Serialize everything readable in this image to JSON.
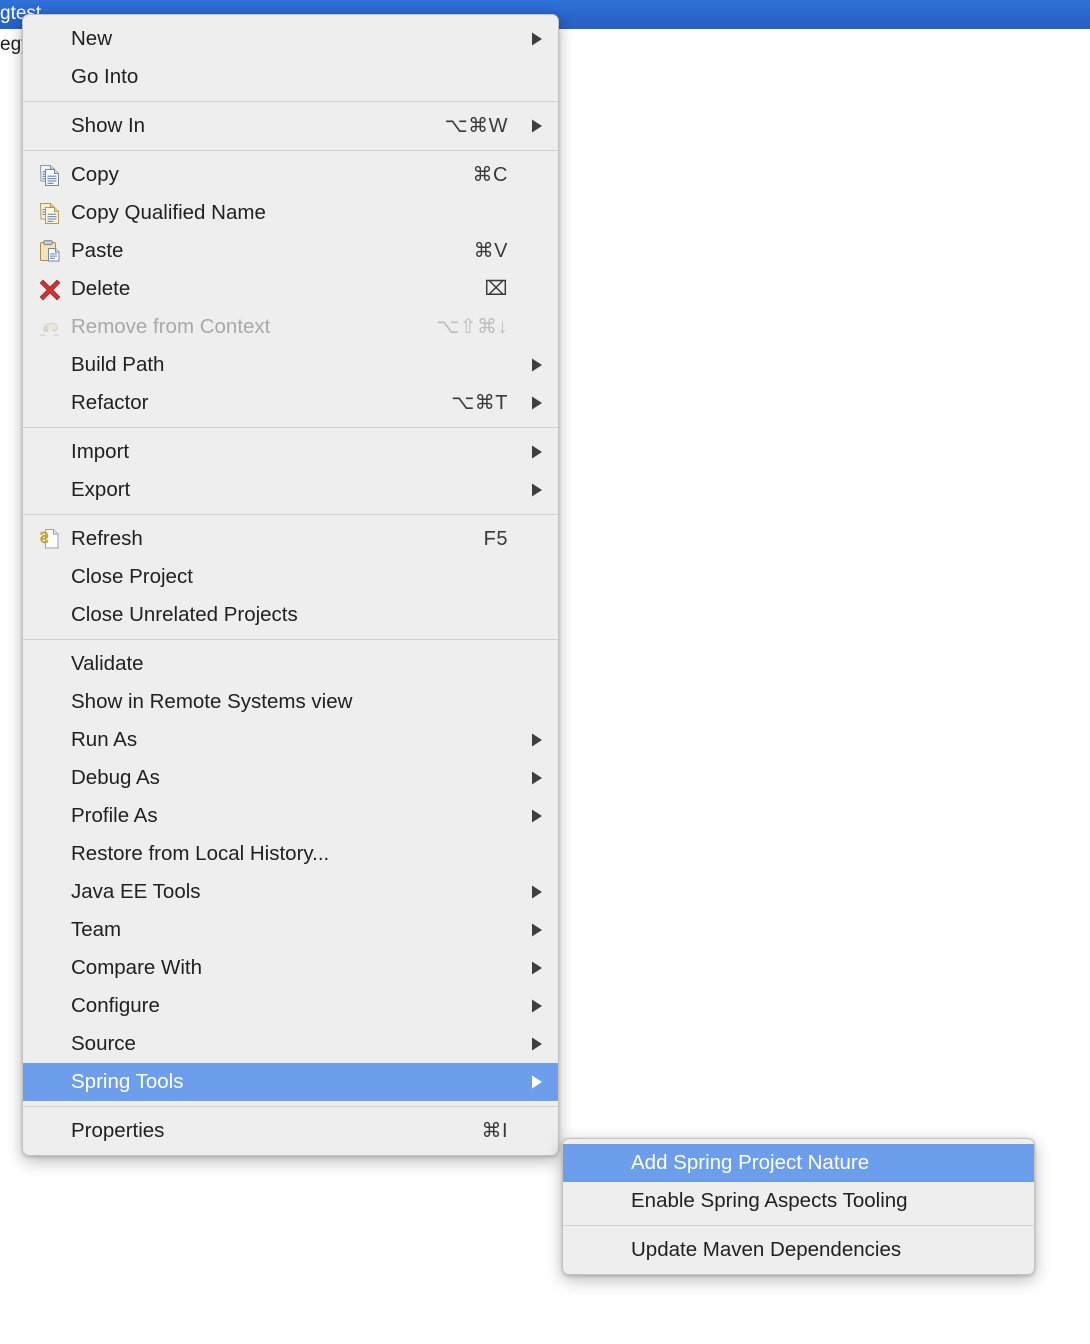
{
  "background": {
    "selected_tree_label": "gtest",
    "tree_label_2": "egy",
    "selection_color": "#2a66cb"
  },
  "theme": {
    "menu_background": "#eeeeee",
    "menu_border": "#c2c2c2",
    "highlight": "#6d9eeb",
    "text": "#212121",
    "disabled_text": "#a9a9a9",
    "separator": "#d2d2d2"
  },
  "context_menu": {
    "name": "project-context-menu",
    "groups": [
      {
        "items": [
          {
            "label": "New",
            "icon": "",
            "accel": "",
            "submenu": true,
            "enabled": true,
            "highlight": false
          },
          {
            "label": "Go Into",
            "icon": "",
            "accel": "",
            "submenu": false,
            "enabled": true,
            "highlight": false
          }
        ]
      },
      {
        "items": [
          {
            "label": "Show In",
            "icon": "",
            "accel": "⌥⌘W",
            "submenu": true,
            "enabled": true,
            "highlight": false
          }
        ]
      },
      {
        "items": [
          {
            "label": "Copy",
            "icon": "copy-icon",
            "accel": "⌘C",
            "submenu": false,
            "enabled": true,
            "highlight": false
          },
          {
            "label": "Copy Qualified Name",
            "icon": "copy-qualified-icon",
            "accel": "",
            "submenu": false,
            "enabled": true,
            "highlight": false
          },
          {
            "label": "Paste",
            "icon": "paste-icon",
            "accel": "⌘V",
            "submenu": false,
            "enabled": true,
            "highlight": false
          },
          {
            "label": "Delete",
            "icon": "delete-icon",
            "accel": "⌧",
            "submenu": false,
            "enabled": true,
            "highlight": false
          },
          {
            "label": "Remove from Context",
            "icon": "remove-context-icon",
            "accel": "⌥⇧⌘↓",
            "submenu": false,
            "enabled": false,
            "highlight": false
          },
          {
            "label": "Build Path",
            "icon": "",
            "accel": "",
            "submenu": true,
            "enabled": true,
            "highlight": false
          },
          {
            "label": "Refactor",
            "icon": "",
            "accel": "⌥⌘T",
            "submenu": true,
            "enabled": true,
            "highlight": false
          }
        ]
      },
      {
        "items": [
          {
            "label": "Import",
            "icon": "",
            "accel": "",
            "submenu": true,
            "enabled": true,
            "highlight": false
          },
          {
            "label": "Export",
            "icon": "",
            "accel": "",
            "submenu": true,
            "enabled": true,
            "highlight": false
          }
        ]
      },
      {
        "items": [
          {
            "label": "Refresh",
            "icon": "refresh-icon",
            "accel": "F5",
            "submenu": false,
            "enabled": true,
            "highlight": false
          },
          {
            "label": "Close Project",
            "icon": "",
            "accel": "",
            "submenu": false,
            "enabled": true,
            "highlight": false
          },
          {
            "label": "Close Unrelated Projects",
            "icon": "",
            "accel": "",
            "submenu": false,
            "enabled": true,
            "highlight": false
          }
        ]
      },
      {
        "items": [
          {
            "label": "Validate",
            "icon": "",
            "accel": "",
            "submenu": false,
            "enabled": true,
            "highlight": false
          },
          {
            "label": "Show in Remote Systems view",
            "icon": "",
            "accel": "",
            "submenu": false,
            "enabled": true,
            "highlight": false
          },
          {
            "label": "Run As",
            "icon": "",
            "accel": "",
            "submenu": true,
            "enabled": true,
            "highlight": false
          },
          {
            "label": "Debug As",
            "icon": "",
            "accel": "",
            "submenu": true,
            "enabled": true,
            "highlight": false
          },
          {
            "label": "Profile As",
            "icon": "",
            "accel": "",
            "submenu": true,
            "enabled": true,
            "highlight": false
          },
          {
            "label": "Restore from Local History...",
            "icon": "",
            "accel": "",
            "submenu": false,
            "enabled": true,
            "highlight": false
          },
          {
            "label": "Java EE Tools",
            "icon": "",
            "accel": "",
            "submenu": true,
            "enabled": true,
            "highlight": false
          },
          {
            "label": "Team",
            "icon": "",
            "accel": "",
            "submenu": true,
            "enabled": true,
            "highlight": false
          },
          {
            "label": "Compare With",
            "icon": "",
            "accel": "",
            "submenu": true,
            "enabled": true,
            "highlight": false
          },
          {
            "label": "Configure",
            "icon": "",
            "accel": "",
            "submenu": true,
            "enabled": true,
            "highlight": false
          },
          {
            "label": "Source",
            "icon": "",
            "accel": "",
            "submenu": true,
            "enabled": true,
            "highlight": false
          },
          {
            "label": "Spring Tools",
            "icon": "",
            "accel": "",
            "submenu": true,
            "enabled": true,
            "highlight": true
          }
        ]
      },
      {
        "items": [
          {
            "label": "Properties",
            "icon": "",
            "accel": "⌘I",
            "submenu": false,
            "enabled": true,
            "highlight": false
          }
        ]
      }
    ]
  },
  "submenu": {
    "name": "spring-tools-submenu",
    "groups": [
      {
        "items": [
          {
            "label": "Add Spring Project Nature",
            "icon": "",
            "accel": "",
            "submenu": false,
            "enabled": true,
            "highlight": true
          },
          {
            "label": "Enable Spring Aspects Tooling",
            "icon": "",
            "accel": "",
            "submenu": false,
            "enabled": true,
            "highlight": false
          }
        ]
      },
      {
        "items": [
          {
            "label": "Update Maven Dependencies",
            "icon": "",
            "accel": "",
            "submenu": false,
            "enabled": true,
            "highlight": false
          }
        ]
      }
    ]
  }
}
